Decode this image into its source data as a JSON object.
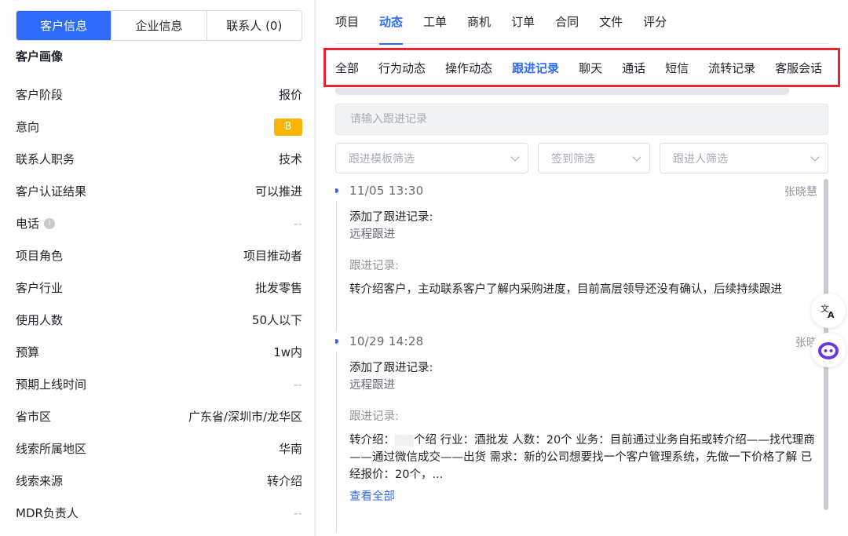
{
  "left": {
    "segments": [
      "客户信息",
      "企业信息",
      "联系人 (0)"
    ],
    "active_segment": 0,
    "section_title": "客户画像",
    "rows": [
      {
        "label": "客户阶段",
        "value": "报价"
      },
      {
        "label": "意向",
        "value": "B",
        "type": "badge",
        "badge_color": "#f7b500"
      },
      {
        "label": "联系人职务",
        "value": "技术"
      },
      {
        "label": "客户认证结果",
        "value": "可以推进"
      },
      {
        "label": "电话",
        "value": "--",
        "info": true
      },
      {
        "label": "项目角色",
        "value": "项目推动者"
      },
      {
        "label": "客户行业",
        "value": "批发零售"
      },
      {
        "label": "使用人数",
        "value": "50人以下"
      },
      {
        "label": "预算",
        "value": "1w内"
      },
      {
        "label": "预期上线时间",
        "value": "--"
      },
      {
        "label": "省市区",
        "value": "广东省/深圳市/龙华区"
      },
      {
        "label": "线索所属地区",
        "value": "华南"
      },
      {
        "label": "线索来源",
        "value": "转介绍"
      },
      {
        "label": "MDR负责人",
        "value": "--"
      }
    ]
  },
  "right": {
    "tabs": [
      "项目",
      "动态",
      "工单",
      "商机",
      "订单",
      "合同",
      "文件",
      "评分"
    ],
    "active_tab": 1,
    "subtabs": [
      "全部",
      "行为动态",
      "操作动态",
      "跟进记录",
      "聊天",
      "通话",
      "短信",
      "流转记录",
      "客服会话"
    ],
    "active_subtab": 3,
    "search_placeholder": "请输入跟进记录",
    "filters": [
      "跟进模板筛选",
      "签到筛选",
      "跟进人筛选"
    ],
    "entries": [
      {
        "time": "11/05   13:30",
        "who": "张晓慧",
        "line1": "添加了跟进记录:",
        "line2": "远程跟进",
        "label": "跟进记录:",
        "body": "转介绍客户，主动联系客户了解内采购进度，目前高层领导还没有确认，后续持续跟进"
      },
      {
        "time": "10/29   14:28",
        "who": "张晓",
        "line1": "添加了跟进记录:",
        "line2": "远程跟进",
        "label": "跟进记录:",
        "body_a": "转介绍：",
        "body_b": "个绍 行业：酒批发 人数：20个 业务：目前通过业务自拓或转介绍——找代理商——通过微信成交——出货 需求：新的公司想要找一个客户管理系统，先做一下价格了解 已经报价：20个，...",
        "more": "查看全部"
      }
    ]
  },
  "colors": {
    "accent": "#2f6bfa",
    "highlight_border": "#e8252f"
  },
  "icons": [
    "translate-icon",
    "assistant-bot-icon",
    "info-icon"
  ]
}
